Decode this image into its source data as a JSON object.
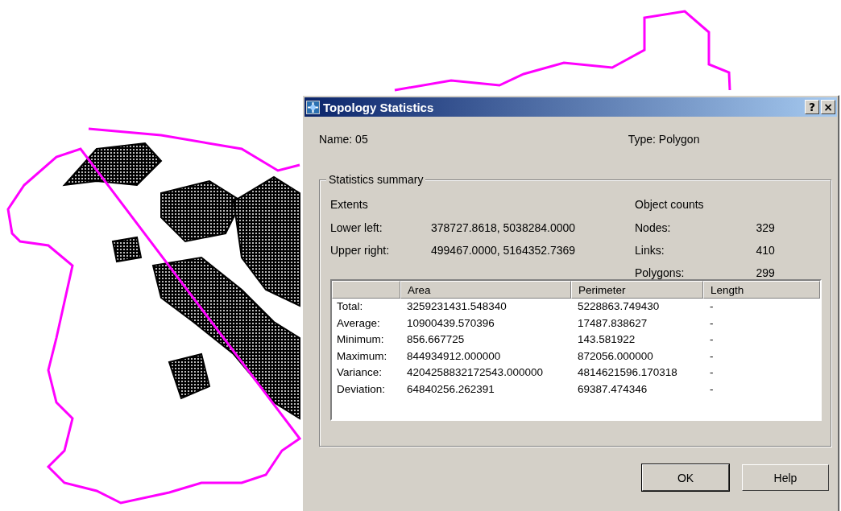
{
  "dialog": {
    "title": "Topology Statistics",
    "title_buttons": [
      "?",
      "×"
    ],
    "name": "Name: 05",
    "type": "Type: Polygon",
    "group_title": "Statistics summary",
    "extents": {
      "heading": "Extents",
      "rows": [
        {
          "label": "Lower left:",
          "value": "378727.8618, 5038284.0000"
        },
        {
          "label": "Upper right:",
          "value": "499467.0000, 5164352.7369"
        }
      ]
    },
    "object_counts": {
      "heading": "Object counts",
      "rows": [
        {
          "label": "Nodes:",
          "value": "329"
        },
        {
          "label": "Links:",
          "value": "410"
        },
        {
          "label": "Polygons:",
          "value": "299"
        }
      ]
    },
    "table": {
      "columns": [
        "Area",
        "Perimeter",
        "Length"
      ],
      "rows": [
        {
          "label": "Total:",
          "cells": [
            "3259231431.548340",
            "5228863.749430",
            "-"
          ]
        },
        {
          "label": "Average:",
          "cells": [
            "10900439.570396",
            "17487.838627",
            "-"
          ]
        },
        {
          "label": "Minimum:",
          "cells": [
            "856.667725",
            "143.581922",
            "-"
          ]
        },
        {
          "label": "Maximum:",
          "cells": [
            "844934912.000000",
            "872056.000000",
            "-"
          ]
        },
        {
          "label": "Variance:",
          "cells": [
            "4204258832172543.000000",
            "4814621596.170318",
            "-"
          ]
        },
        {
          "label": "Deviation:",
          "cells": [
            "64840256.262391",
            "69387.474346",
            "-"
          ]
        }
      ]
    },
    "buttons": [
      "OK",
      "Help"
    ]
  }
}
